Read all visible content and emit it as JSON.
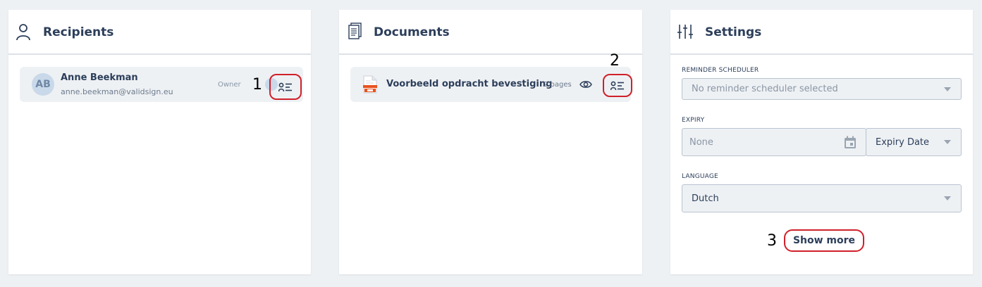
{
  "recipients": {
    "title": "Recipients",
    "items": [
      {
        "initials": "AB",
        "name": "Anne Beekman",
        "email": "anne.beekman@validsign.eu",
        "role": "Owner"
      }
    ]
  },
  "documents": {
    "title": "Documents",
    "items": [
      {
        "name": "Voorbeeld opdracht bevestiging",
        "pages": "2 pages"
      }
    ]
  },
  "settings": {
    "title": "Settings",
    "reminder": {
      "label": "REMINDER SCHEDULER",
      "value": "No reminder scheduler selected"
    },
    "expiry": {
      "label": "EXPIRY",
      "value": "None",
      "type_value": "Expiry Date"
    },
    "language": {
      "label": "LANGUAGE",
      "value": "Dutch"
    },
    "show_more_label": "Show more"
  },
  "annotations": {
    "one": "1",
    "two": "2",
    "three": "3"
  },
  "colors": {
    "accent_ring": "#d0202a",
    "title_text": "#2c3e5a",
    "row_background": "#eef1f4",
    "page_background": "#eef1f4"
  },
  "icons": {
    "recipients_header": "person-outline-icon",
    "documents_header": "documents-stack-icon",
    "settings_header": "sliders-icon",
    "recipient_details": "id-card-list-icon",
    "document_preview": "eye-icon",
    "document_details": "id-card-list-icon",
    "document_file": "pdf-file-icon",
    "expiry_calendar": "calendar-icon"
  }
}
